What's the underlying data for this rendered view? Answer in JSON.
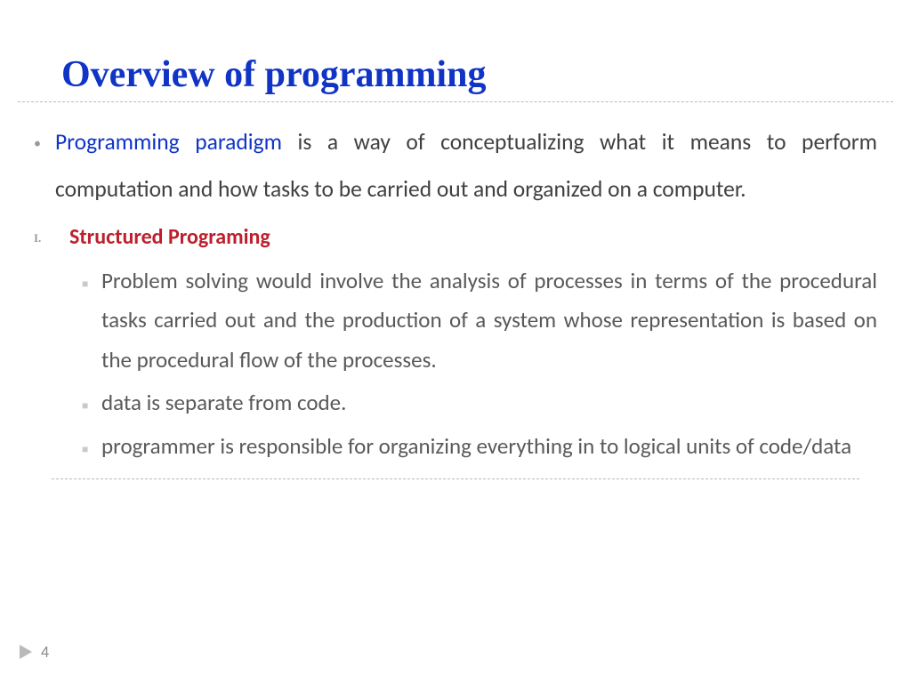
{
  "title": "Overview  of programming",
  "para": {
    "tag": "Programming paradigm ",
    "rest": "is a way of conceptualizing what it means to perform computation and how tasks to be carried out  and organized on a computer."
  },
  "section": {
    "num": "I.",
    "label": "Structured Programing"
  },
  "bullets": [
    "Problem solving would involve the analysis of processes in terms of the procedural tasks carried out and the production of a system whose representation is based on the procedural flow of the processes.",
    "data is separate from code.",
    "programmer is responsible for organizing everything in to logical units of code/data"
  ],
  "page": "4"
}
